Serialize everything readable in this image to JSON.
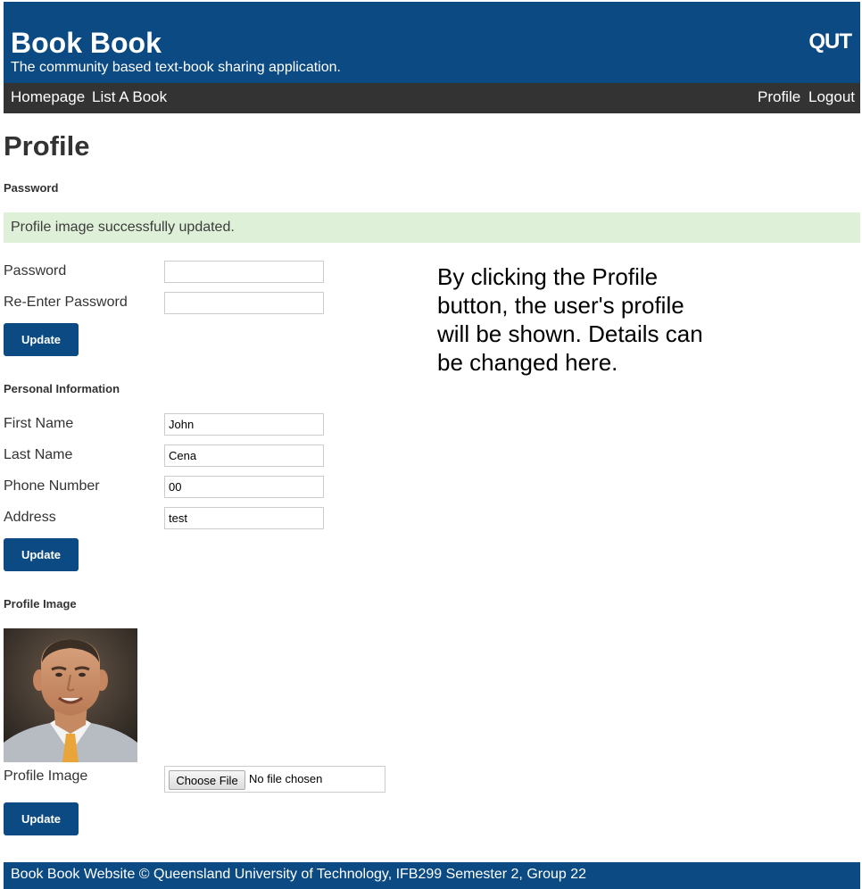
{
  "header": {
    "title": "Book Book",
    "tagline": "The community based text-book sharing application.",
    "logo_text": "QUT"
  },
  "nav": {
    "left": [
      "Homepage",
      "List A Book"
    ],
    "right": [
      "Profile",
      "Logout"
    ]
  },
  "page": {
    "title": "Profile"
  },
  "password_section": {
    "heading": "Password",
    "alert": "Profile image successfully updated.",
    "fields": [
      {
        "label": "Password",
        "value": ""
      },
      {
        "label": "Re-Enter Password",
        "value": ""
      }
    ],
    "button": "Update"
  },
  "personal_section": {
    "heading": "Personal Information",
    "fields": [
      {
        "label": "First Name",
        "value": "John"
      },
      {
        "label": "Last Name",
        "value": "Cena"
      },
      {
        "label": "Phone Number",
        "value": "00"
      },
      {
        "label": "Address",
        "value": "test"
      }
    ],
    "button": "Update"
  },
  "image_section": {
    "heading": "Profile Image",
    "field_label": "Profile Image",
    "choose_file": "Choose File",
    "file_status": "No file chosen",
    "button": "Update"
  },
  "annotation": "By clicking the Profile button, the user's profile will be shown. Details can be changed here.",
  "footer": {
    "text": "Book Book Website © Queensland University of Technology, IFB299 Semester 2, Group 22"
  },
  "colors": {
    "brand": "#0b4a82",
    "nav_bg": "#333333",
    "alert_bg": "#dff0d8"
  }
}
